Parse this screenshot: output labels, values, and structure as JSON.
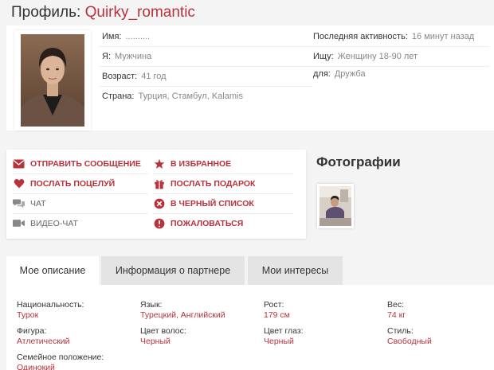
{
  "header": {
    "title_prefix": "Профиль:",
    "username": "Quirky_romantic"
  },
  "profile": {
    "name_label": "Имя:",
    "name_value": "..........",
    "gender_label": "Я:",
    "gender_value": "Мужчина",
    "age_label": "Возраст:",
    "age_value": "41 год",
    "country_label": "Страна:",
    "country_value": "Турция, Стамбул, Kalamis",
    "activity_label": "Последняя активность:",
    "activity_value": "16 минут назад",
    "seeking_label": "Ищу:",
    "seeking_value": "Женщину 18-90 лет",
    "purpose_label": "для:",
    "purpose_value": "Дружба"
  },
  "actions": [
    {
      "label": "ОТПРАВИТЬ СООБЩЕНИЕ",
      "icon": "envelope-icon",
      "style": "red"
    },
    {
      "label": "В ИЗБРАННОЕ",
      "icon": "star-icon",
      "style": "red"
    },
    {
      "label": "ПОСЛАТЬ ПОЦЕЛУЙ",
      "icon": "heart-icon",
      "style": "red"
    },
    {
      "label": "ПОСЛАТЬ ПОДАРОК",
      "icon": "gift-icon",
      "style": "red"
    },
    {
      "label": "ЧАТ",
      "icon": "chat-bubbles-icon",
      "style": "gray"
    },
    {
      "label": "В ЧЕРНЫЙ СПИСОК",
      "icon": "block-x-icon",
      "style": "red"
    },
    {
      "label": "ВИДЕО-ЧАТ",
      "icon": "video-camera-icon",
      "style": "gray"
    },
    {
      "label": "ПОЖАЛОВАТЬСЯ",
      "icon": "exclamation-icon",
      "style": "red"
    }
  ],
  "photos": {
    "title": "Фотографии"
  },
  "tabs": [
    {
      "label": "Мое описание",
      "active": true
    },
    {
      "label": "Информация о партнере",
      "active": false
    },
    {
      "label": "Мои интересы",
      "active": false
    }
  ],
  "details": {
    "nationality_label": "Национальность:",
    "nationality_value": "Турок",
    "language_label": "Язык:",
    "language_value": "Турецкий, Английский",
    "height_label": "Рост:",
    "height_value": "179 см",
    "weight_label": "Вес:",
    "weight_value": "74 кг",
    "figure_label": "Фигура:",
    "figure_value": "Атлетический",
    "hair_label": "Цвет волос:",
    "hair_value": "Черный",
    "eyes_label": "Цвет глаз:",
    "eyes_value": "Черный",
    "style_label": "Стиль:",
    "style_value": "Свободный",
    "marital_label": "Семейное положение:",
    "marital_value": "Одинокий"
  },
  "colors": {
    "accent": "#b8323b",
    "muted": "#888888",
    "tab_inactive": "#e4e4e4"
  }
}
